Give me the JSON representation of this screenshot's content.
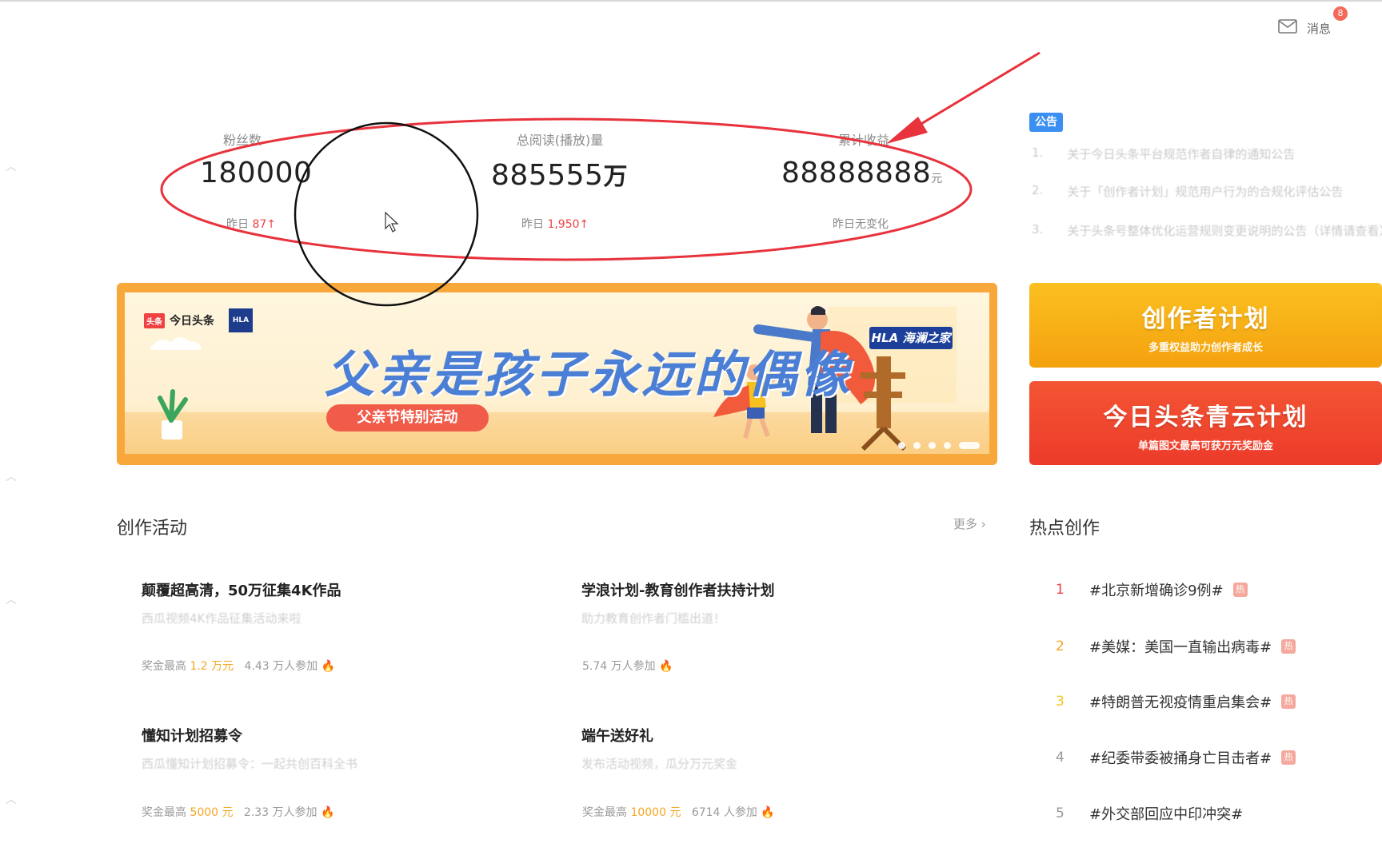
{
  "header": {
    "message_label": "消息",
    "message_badge": "8"
  },
  "stats": [
    {
      "label": "粉丝数",
      "value": "180000",
      "unit": "",
      "sub_prefix": "昨日",
      "sub_value": "87↑"
    },
    {
      "label": "总阅读(播放)量",
      "value": "885555",
      "unit": "万",
      "sub_prefix": "昨日",
      "sub_value": "1,950↑"
    },
    {
      "label": "累计收益",
      "value": "88888888",
      "unit": "元",
      "sub_prefix": "昨日无变化",
      "sub_value": ""
    }
  ],
  "notice": {
    "tag": "公告",
    "items": [
      {
        "num": "1.",
        "text": "关于今日头条平台规范作者自律的通知公告"
      },
      {
        "num": "2.",
        "text": "关于「创作者计划」规范用户行为的合规化评估公告"
      },
      {
        "num": "3.",
        "text": "关于头条号整体优化运营规则变更说明的公告（详情请查看）"
      }
    ]
  },
  "banner": {
    "brand": "今日头条",
    "brand_tag": "头条",
    "hla_logo": "HLA",
    "hla_tag": "HLA 海澜之家",
    "title": "父亲是孩子永远的偶像",
    "button": "父亲节特别活动",
    "dots": 5
  },
  "cards": [
    {
      "title": "创作者计划",
      "subtitle": "多重权益助力创作者成长"
    },
    {
      "title": "今日头条青云计划",
      "subtitle": "单篇图文最高可获万元奖励金"
    }
  ],
  "activities": {
    "title": "创作活动",
    "more": "更多 ›",
    "items": [
      {
        "title": "颠覆超高清，50万征集4K作品",
        "desc": "西瓜视频4K作品征集活动来啦",
        "prize_label": "奖金最高",
        "prize": "1.2 万元",
        "participants": "4.43 万人参加"
      },
      {
        "title": "学浪计划-教育创作者扶持计划",
        "desc": "助力教育创作者门槛出道！",
        "prize_label": "",
        "prize": "",
        "participants": "5.74 万人参加"
      },
      {
        "title": "懂知计划招募令",
        "desc": "西瓜懂知计划招募令：一起共创百科全书",
        "prize_label": "奖金最高",
        "prize": "5000 元",
        "participants": "2.33 万人参加"
      },
      {
        "title": "端午送好礼",
        "desc": "发布活动视频，瓜分万元奖金",
        "prize_label": "奖金最高",
        "prize": "10000 元",
        "participants": "6714 人参加"
      }
    ]
  },
  "hot": {
    "title": "热点创作",
    "badge": "热",
    "items": [
      {
        "num": "1",
        "text": "#北京新增确诊9例#",
        "color": "#f04142"
      },
      {
        "num": "2",
        "text": "#美媒：美国一直输出病毒#",
        "color": "#f5a623"
      },
      {
        "num": "3",
        "text": "#特朗普无视疫情重启集会#",
        "color": "#f5c623"
      },
      {
        "num": "4",
        "text": "#纪委带委被捅身亡目击者#",
        "color": "#999999"
      },
      {
        "num": "5",
        "text": "#外交部回应中印冲突#",
        "color": "#999999"
      }
    ]
  },
  "colors": {
    "accent_red": "#f04142",
    "annotation_red": "#e8323c",
    "notice_blue": "#3b8ff3"
  }
}
